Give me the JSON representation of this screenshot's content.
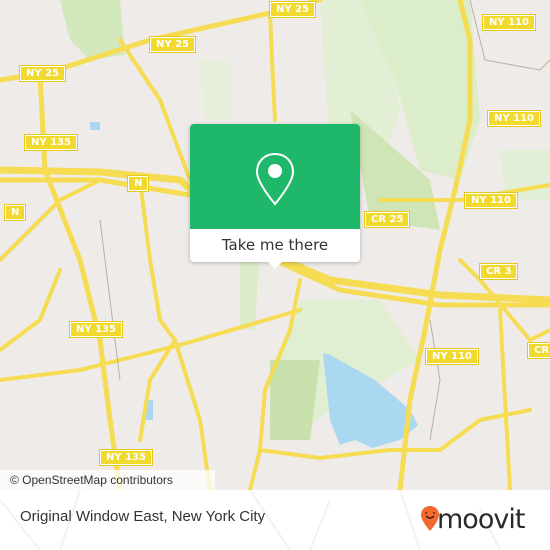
{
  "map": {
    "shields": [
      {
        "label": "NY 25",
        "pos": "top-center"
      },
      {
        "label": "NY 110",
        "pos": "top-right"
      },
      {
        "label": "NY 25",
        "pos": "top-left-1"
      },
      {
        "label": "NY 25",
        "pos": "top-left-2"
      },
      {
        "label": "NY 135",
        "pos": "left-upper"
      },
      {
        "label": "NY 110",
        "pos": "right-upper"
      },
      {
        "label": "N",
        "pos": "interchange"
      },
      {
        "label": "N",
        "pos": "left-edge"
      },
      {
        "label": "NY 110",
        "pos": "right-mid"
      },
      {
        "label": "CR 25",
        "pos": "center-right"
      },
      {
        "label": "CR 3",
        "pos": "right"
      },
      {
        "label": "NY 135",
        "pos": "left-mid"
      },
      {
        "label": "NY 110",
        "pos": "lower-right"
      },
      {
        "label": "CR",
        "pos": "right-edge"
      },
      {
        "label": "NY 135",
        "pos": "bottom-left"
      }
    ],
    "attribution": "© OpenStreetMap contributors",
    "colors": {
      "land": "#efebe8",
      "park": "#d9ecc4",
      "water": "#a9d8f0",
      "road": "#f5dc52"
    }
  },
  "popup": {
    "icon": "location-pin-icon",
    "button_label": "Take me there",
    "color": "#1fb86b"
  },
  "footer": {
    "title": "Original Window East, New York City",
    "brand": "moovit",
    "brand_color": "#f26a2e"
  }
}
